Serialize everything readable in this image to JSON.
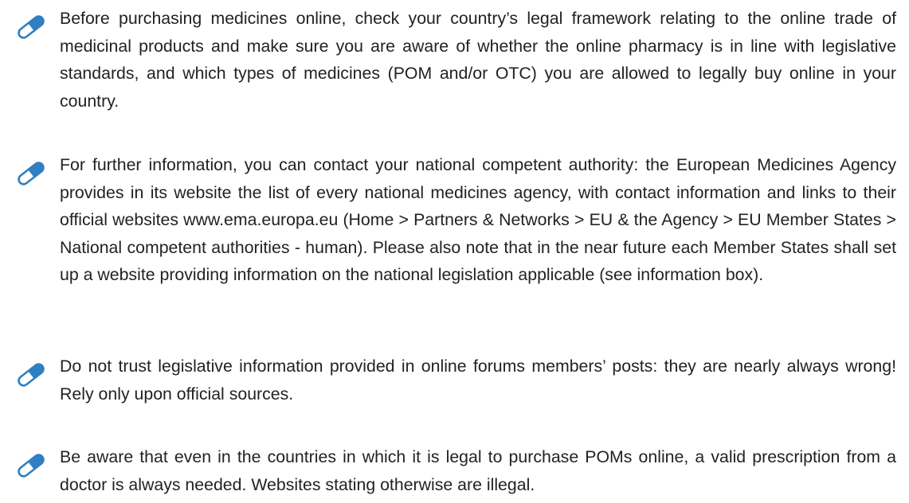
{
  "tips": [
    {
      "icon": "pill-capsule-icon",
      "text": "Before purchasing medicines online, check your country’s legal framework relating to the online trade of medicinal products and make sure you are aware of whether the online pharmacy is in line with legislative standards, and which types of medicines (POM and/or OTC) you are allowed to legally buy online in your country."
    },
    {
      "icon": "pill-capsule-icon",
      "text": "For further information, you can contact your national competent authority: the European Medicines Agency provides in its website the list of every national medicines agency, with contact information and links to their official websites www.ema.europa.eu (Home > Partners & Networks > EU & the Agency > EU Member States > National competent authorities - human). Please also note that in the near future each Member States shall set up a website providing information on the national legislation applicable (see information box)."
    },
    {
      "icon": "pill-capsule-icon",
      "text": "Do not trust legislative information provided in online forums members’ posts: they are nearly always wrong! Rely only upon official sources."
    },
    {
      "icon": "pill-capsule-icon",
      "text": "Be aware that even in the countries in which it is legal to purchase POMs online, a valid prescription from a doctor is always needed. Websites stating otherwise are illegal."
    }
  ],
  "colors": {
    "icon_stroke": "#2f7fc1",
    "icon_fill": "#ffffff",
    "text": "#222222"
  }
}
